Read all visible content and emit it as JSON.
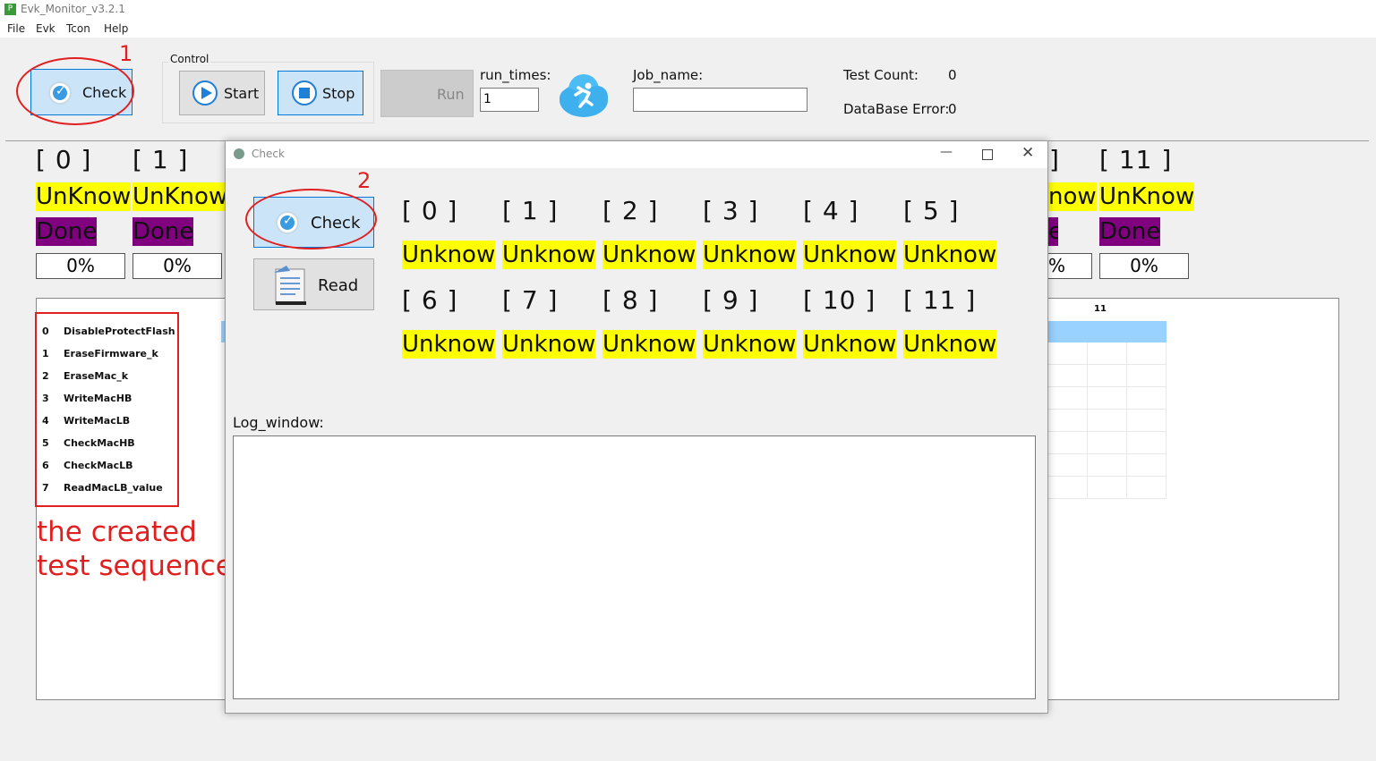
{
  "app": {
    "title": "Evk_Monitor_v3.2.1",
    "icon_letter": "P"
  },
  "menu": [
    "File",
    "Evk",
    "Tcon",
    "Help"
  ],
  "toolbar": {
    "check_label": "Check",
    "control_group_label": "Control",
    "start_label": "Start",
    "stop_label": "Stop",
    "run_label": "Run",
    "run_times_label": "run_times:",
    "run_times_value": "1",
    "job_name_label": "Job_name:",
    "job_name_value": "",
    "test_count_label": "Test Count:",
    "test_count_value": "0",
    "db_error_label": "DataBase Error:",
    "db_error_value": "0"
  },
  "annotations": {
    "marker_1": "1",
    "marker_2": "2",
    "note_line1": "the created",
    "note_line2": "test sequence"
  },
  "slots": {
    "slot_0": {
      "index": "[ 0 ]",
      "status": "UnKnow",
      "state": "Done",
      "progress": "0%"
    },
    "slot_1": {
      "index": "[ 1 ]",
      "status": "UnKnow",
      "state": "Done",
      "progress": "0%"
    },
    "slot_10": {
      "index": "",
      "status": "now",
      "state": "e",
      "progress": "%"
    },
    "slot_11": {
      "index": "[ 11 ]",
      "status": "UnKnow",
      "state": "Done",
      "progress": "0%"
    }
  },
  "grid_header_11": "11",
  "sequence": [
    {
      "num": "0",
      "name": "DisableProtectFlash"
    },
    {
      "num": "1",
      "name": "EraseFirmware_k"
    },
    {
      "num": "2",
      "name": "EraseMac_k"
    },
    {
      "num": "3",
      "name": "WriteMacHB"
    },
    {
      "num": "4",
      "name": "WriteMacLB"
    },
    {
      "num": "5",
      "name": "CheckMacHB"
    },
    {
      "num": "6",
      "name": "CheckMacLB"
    },
    {
      "num": "7",
      "name": "ReadMacLB_value"
    }
  ],
  "dialog": {
    "title": "Check",
    "check_label": "Check",
    "read_label": "Read",
    "log_label": "Log_window:",
    "log_text": "",
    "slots": [
      {
        "index": "[ 0 ]",
        "status": "Unknow"
      },
      {
        "index": "[ 1 ]",
        "status": "Unknow"
      },
      {
        "index": "[ 2 ]",
        "status": "Unknow"
      },
      {
        "index": "[ 3 ]",
        "status": "Unknow"
      },
      {
        "index": "[ 4 ]",
        "status": "Unknow"
      },
      {
        "index": "[ 5 ]",
        "status": "Unknow"
      },
      {
        "index": "[ 6 ]",
        "status": "Unknow"
      },
      {
        "index": "[ 7 ]",
        "status": "Unknow"
      },
      {
        "index": "[ 8 ]",
        "status": "Unknow"
      },
      {
        "index": "[ 9 ]",
        "status": "Unknow"
      },
      {
        "index": "[ 10 ]",
        "status": "Unknow"
      },
      {
        "index": "[ 11 ]",
        "status": "Unknow"
      }
    ]
  },
  "colors": {
    "status_yellow": "#ffff00",
    "done_purple": "#800080",
    "annotation_red": "#e02020",
    "accent_blue": "#0078d7"
  }
}
